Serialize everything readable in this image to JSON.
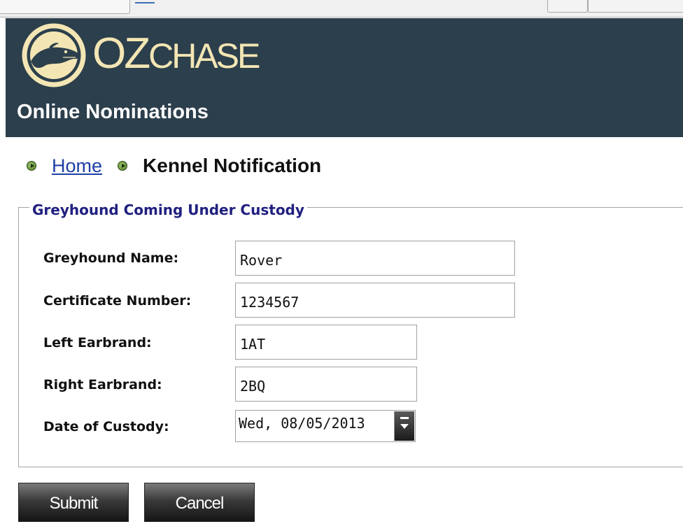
{
  "header": {
    "logo_main": "OZ",
    "logo_rest": "CHASE",
    "subtitle": "Online Nominations",
    "brand_colors": {
      "header_bg": "#2c3f4c",
      "logo_cream": "#f3e6b4"
    },
    "logo_icon": "greyhound-head-logo-icon"
  },
  "breadcrumb": {
    "home": "Home",
    "current": "Kennel Notification",
    "bullet_icon": "green-arrow-bullet-icon"
  },
  "form": {
    "legend": "Greyhound Coming Under Custody",
    "fields": [
      {
        "label": "Greyhound Name:",
        "value": "Rover"
      },
      {
        "label": "Certificate Number:",
        "value": "1234567"
      },
      {
        "label": "Left Earbrand:",
        "value": "1AT"
      },
      {
        "label": "Right Earbrand:",
        "value": "2BQ"
      },
      {
        "label": "Date of Custody:",
        "value": "Wed, 08/05/2013"
      }
    ]
  },
  "buttons": {
    "submit": "Submit",
    "cancel": "Cancel"
  }
}
